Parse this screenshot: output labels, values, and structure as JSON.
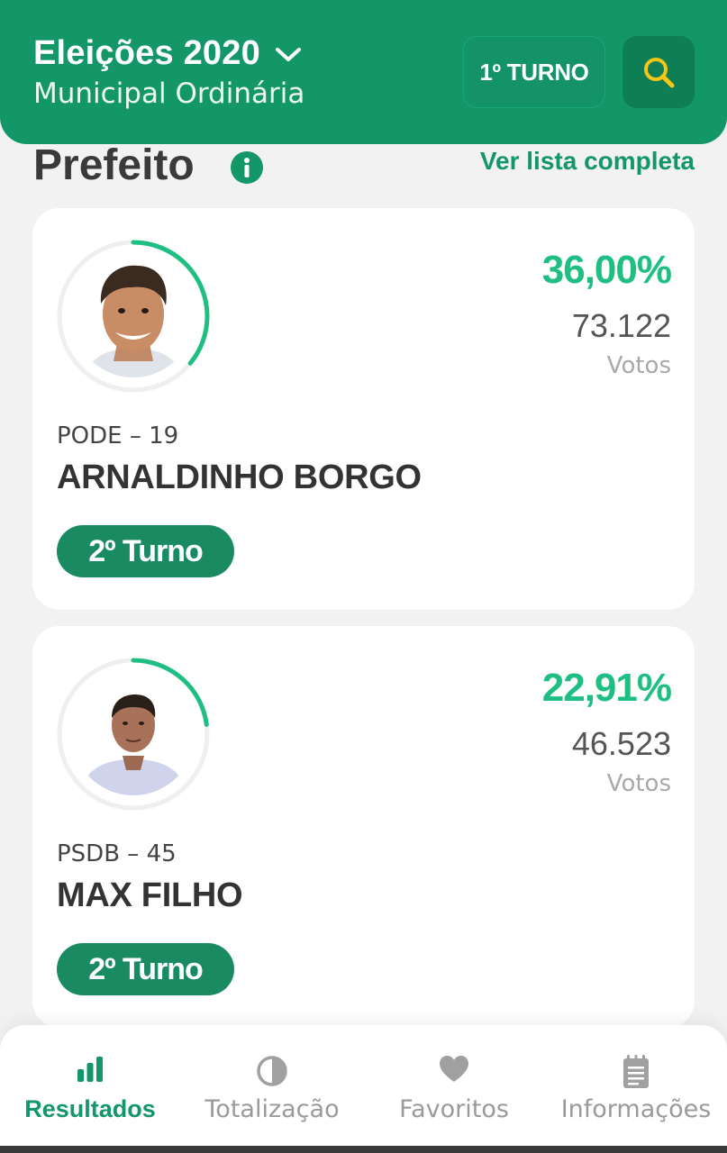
{
  "header": {
    "title": "Eleições 2020",
    "subtitle": "Municipal Ordinária",
    "turno_label": "1º TURNO",
    "brand_color": "#149768"
  },
  "section": {
    "title": "Prefeito",
    "link": "Ver lista completa"
  },
  "candidates": [
    {
      "percent": "36,00%",
      "percent_value": 36.0,
      "votes": "73.122",
      "votes_label": "Votos",
      "party": "PODE – 19",
      "name": "ARNALDINHO BORGO",
      "badge": "2º Turno"
    },
    {
      "percent": "22,91%",
      "percent_value": 22.91,
      "votes": "46.523",
      "votes_label": "Votos",
      "party": "PSDB – 45",
      "name": "MAX FILHO",
      "badge": "2º Turno"
    }
  ],
  "nav": [
    {
      "label": "Resultados",
      "icon": "bar-chart-icon",
      "active": true
    },
    {
      "label": "Totalização",
      "icon": "pie-half-icon",
      "active": false
    },
    {
      "label": "Favoritos",
      "icon": "heart-icon",
      "active": false
    },
    {
      "label": "Informações",
      "icon": "notepad-icon",
      "active": false
    }
  ]
}
